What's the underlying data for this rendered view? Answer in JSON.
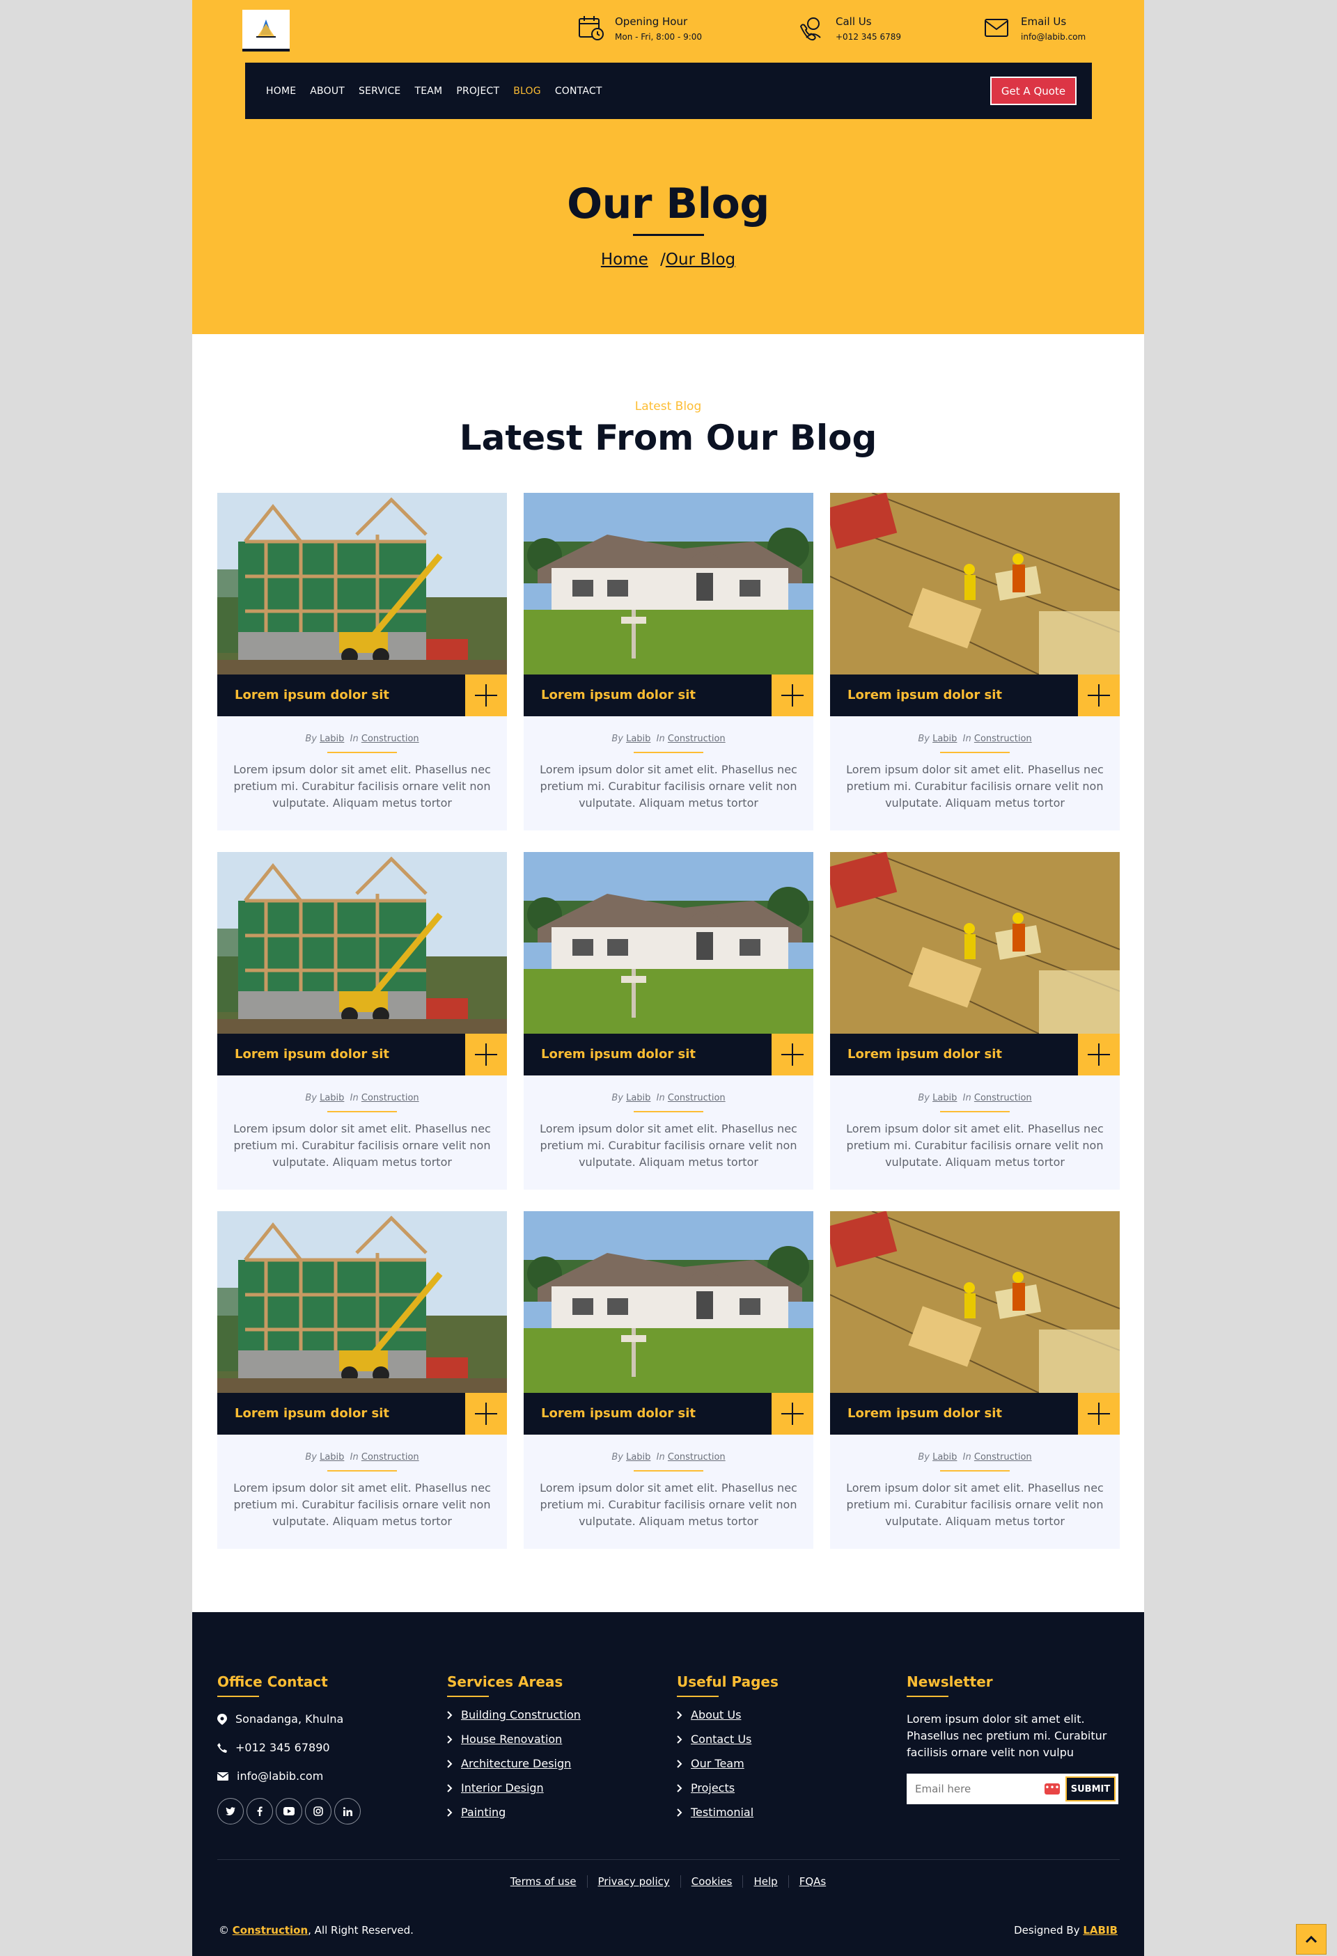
{
  "header": {
    "logo_icon": "construction-logo",
    "info": [
      {
        "icon": "clock-calendar-icon",
        "title": "Opening Hour",
        "detail": "Mon - Fri, 8:00 - 9:00"
      },
      {
        "icon": "phone-support-icon",
        "title": "Call Us",
        "detail": "+012 345 6789"
      },
      {
        "icon": "email-icon",
        "title": "Email Us",
        "detail": "info@labib.com"
      }
    ]
  },
  "nav": {
    "items": [
      "HOME",
      "ABOUT",
      "SERVICE",
      "TEAM",
      "PROJECT",
      "BLOG",
      "CONTACT"
    ],
    "active": "BLOG",
    "cta": "Get A Quote"
  },
  "hero": {
    "title": "Our Blog",
    "breadcrumb_home": "Home",
    "breadcrumb_sep": "/",
    "breadcrumb_current": "Our Blog"
  },
  "section": {
    "eyebrow": "Latest Blog",
    "title": "Latest From Our Blog"
  },
  "posts": [
    {
      "image": "house-frame-crane",
      "title": "Lorem ipsum dolor sit",
      "by_label": "By",
      "author": "Labib",
      "in_label": "In",
      "category": "Construction",
      "excerpt": "Lorem ipsum dolor sit amet elit. Phasellus nec pretium mi. Curabitur facilisis ornare velit non vulputate. Aliquam metus tortor"
    },
    {
      "image": "suburban-house",
      "title": "Lorem ipsum dolor sit",
      "by_label": "By",
      "author": "Labib",
      "in_label": "In",
      "category": "Construction",
      "excerpt": "Lorem ipsum dolor sit amet elit. Phasellus nec pretium mi. Curabitur facilisis ornare velit non vulputate. Aliquam metus tortor"
    },
    {
      "image": "workers-site",
      "title": "Lorem ipsum dolor sit",
      "by_label": "By",
      "author": "Labib",
      "in_label": "In",
      "category": "Construction",
      "excerpt": "Lorem ipsum dolor sit amet elit. Phasellus nec pretium mi. Curabitur facilisis ornare velit non vulputate. Aliquam metus tortor"
    },
    {
      "image": "house-frame-crane",
      "title": "Lorem ipsum dolor sit",
      "by_label": "By",
      "author": "Labib",
      "in_label": "In",
      "category": "Construction",
      "excerpt": "Lorem ipsum dolor sit amet elit. Phasellus nec pretium mi. Curabitur facilisis ornare velit non vulputate. Aliquam metus tortor"
    },
    {
      "image": "suburban-house",
      "title": "Lorem ipsum dolor sit",
      "by_label": "By",
      "author": "Labib",
      "in_label": "In",
      "category": "Construction",
      "excerpt": "Lorem ipsum dolor sit amet elit. Phasellus nec pretium mi. Curabitur facilisis ornare velit non vulputate. Aliquam metus tortor"
    },
    {
      "image": "workers-site",
      "title": "Lorem ipsum dolor sit",
      "by_label": "By",
      "author": "Labib",
      "in_label": "In",
      "category": "Construction",
      "excerpt": "Lorem ipsum dolor sit amet elit. Phasellus nec pretium mi. Curabitur facilisis ornare velit non vulputate. Aliquam metus tortor"
    },
    {
      "image": "house-frame-crane",
      "title": "Lorem ipsum dolor sit",
      "by_label": "By",
      "author": "Labib",
      "in_label": "In",
      "category": "Construction",
      "excerpt": "Lorem ipsum dolor sit amet elit. Phasellus nec pretium mi. Curabitur facilisis ornare velit non vulputate. Aliquam metus tortor"
    },
    {
      "image": "suburban-house",
      "title": "Lorem ipsum dolor sit",
      "by_label": "By",
      "author": "Labib",
      "in_label": "In",
      "category": "Construction",
      "excerpt": "Lorem ipsum dolor sit amet elit. Phasellus nec pretium mi. Curabitur facilisis ornare velit non vulputate. Aliquam metus tortor"
    },
    {
      "image": "workers-site",
      "title": "Lorem ipsum dolor sit",
      "by_label": "By",
      "author": "Labib",
      "in_label": "In",
      "category": "Construction",
      "excerpt": "Lorem ipsum dolor sit amet elit. Phasellus nec pretium mi. Curabitur facilisis ornare velit non vulputate. Aliquam metus tortor"
    }
  ],
  "footer": {
    "office": {
      "heading": "Office Contact",
      "address": "Sonadanga, Khulna",
      "phone": "+012 345 67890",
      "email": "info@labib.com",
      "socials": [
        "twitter-icon",
        "facebook-icon",
        "youtube-icon",
        "instagram-icon",
        "linkedin-icon"
      ]
    },
    "services": {
      "heading": "Services Areas",
      "links": [
        "Building Construction",
        "House Renovation",
        "Architecture Design",
        "Interior Design",
        "Painting"
      ]
    },
    "pages": {
      "heading": "Useful Pages",
      "links": [
        "About Us",
        "Contact Us",
        "Our Team",
        "Projects",
        "Testimonial"
      ]
    },
    "newsletter": {
      "heading": "Newsletter",
      "text": "Lorem ipsum dolor sit amet elit. Phasellus nec pretium mi. Curabitur facilisis ornare velit non vulpu",
      "placeholder": "Email here",
      "button": "SUBMIT"
    },
    "legal": [
      "Terms of use",
      "Privacy policy",
      "Cookies",
      "Help",
      "FQAs"
    ],
    "copyright_prefix": "© ",
    "copyright_brand": "Construction",
    "copyright_suffix": ", All Right Reserved.",
    "designed_prefix": "Designed By ",
    "designed_brand": "LABIB"
  },
  "colors": {
    "accent": "#fdbd33",
    "navy": "#0b1223",
    "cta_red": "#dc3545",
    "card_bg": "#f4f6fe"
  },
  "back_to_top_icon": "chevron-up-icon"
}
